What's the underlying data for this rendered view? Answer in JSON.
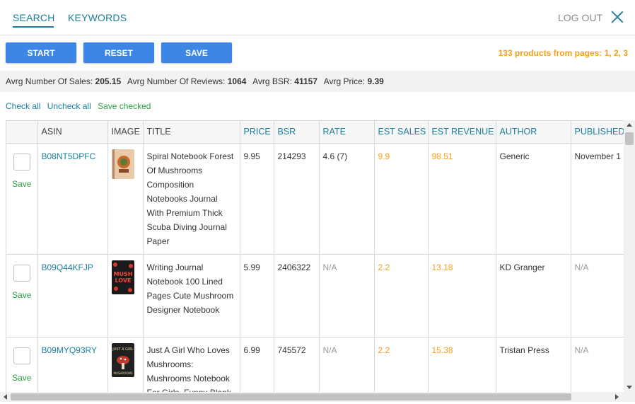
{
  "header": {
    "tabs": [
      {
        "label": "SEARCH",
        "active": true
      },
      {
        "label": "KEYWORDS",
        "active": false
      }
    ],
    "logout_label": "LOG OUT"
  },
  "toolbar": {
    "start_label": "START",
    "reset_label": "RESET",
    "save_label": "SAVE",
    "products_summary": "133 products from pages: 1, 2, 3"
  },
  "stats": {
    "sales_label": "Avrg Number Of Sales:",
    "sales_value": "205.15",
    "reviews_label": "Avrg Number Of Reviews:",
    "reviews_value": "1064",
    "bsr_label": "Avrg BSR:",
    "bsr_value": "41157",
    "price_label": "Avrg Price:",
    "price_value": "9.39"
  },
  "actions": {
    "check_all": "Check all",
    "uncheck_all": "Uncheck all",
    "save_checked": "Save checked"
  },
  "table": {
    "columns": [
      "",
      "ASIN",
      "IMAGE",
      "TITLE",
      "PRICE",
      "BSR",
      "RATE",
      "EST SALES",
      "EST REVENUE",
      "AUTHOR",
      "PUBLISHED"
    ],
    "save_label": "Save",
    "rows": [
      {
        "asin": "B08NT5DPFC",
        "title": "Spiral Notebook Forest Of Mushrooms Composition Notebooks Journal With Premium Thick Scuba Diving Journal Paper",
        "price": "9.95",
        "bsr": "214293",
        "rate": "4.6 (7)",
        "est_sales": "9.9",
        "est_revenue": "98.51",
        "author": "Generic",
        "published": "November 1"
      },
      {
        "asin": "B09Q44KFJP",
        "title": "Writing Journal Notebook 100 Lined Pages Cute Mushroom Designer Notebook",
        "price": "5.99",
        "bsr": "2406322",
        "rate": "N/A",
        "est_sales": "2.2",
        "est_revenue": "13.18",
        "author": "KD Granger",
        "published": "N/A"
      },
      {
        "asin": "B09MYQ93RY",
        "title": "Just A Girl Who Loves Mushrooms: Mushrooms Notebook For Girls, Funny Blank",
        "price": "6.99",
        "bsr": "745572",
        "rate": "N/A",
        "est_sales": "2.2",
        "est_revenue": "15.38",
        "author": "Tristan Press",
        "published": "N/A"
      }
    ]
  },
  "thumbs": {
    "row0_text": "",
    "row1_text": "MUSH LOVE",
    "row2_text": "JUST A GIRL"
  },
  "colors": {
    "accent": "#1a7f9c",
    "button": "#3d86e6",
    "orange": "#f5a01a",
    "green": "#2aa147"
  }
}
